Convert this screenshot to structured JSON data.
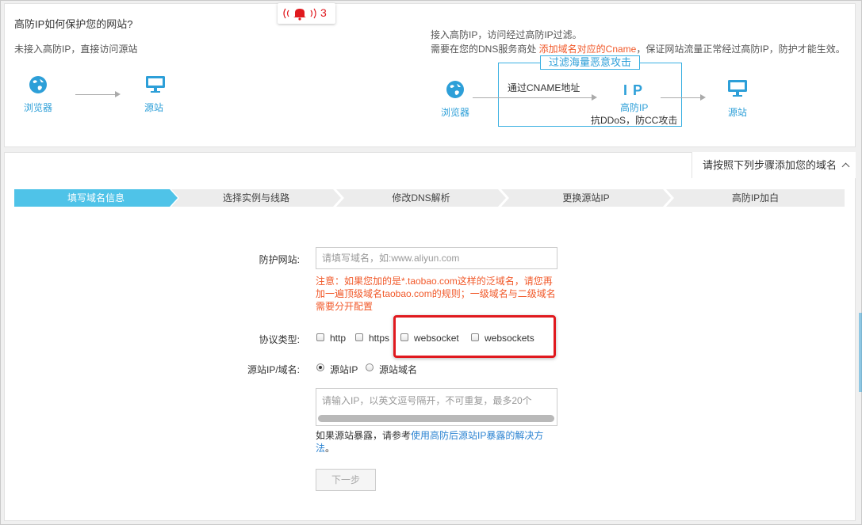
{
  "header": {
    "title": "高防IP如何保护您的网站?",
    "notification": {
      "count": "3",
      "icon": "bell-icon"
    }
  },
  "diagram_left": {
    "caption": "未接入高防IP，直接访问源站",
    "browser_label": "浏览器",
    "origin_label": "源站"
  },
  "diagram_right": {
    "line1": "接入高防IP，访问经过高防IP过滤。",
    "line2_prefix": "需要在您的DNS服务商处 ",
    "line2_highlight": "添加域名对应的Cname",
    "line2_suffix": "，保证网站流量正常经过高防IP，防护才能生效。",
    "filter_tag": "过滤海量恶意攻击",
    "cname_text": "通过CNAME地址",
    "ip_big": "I P",
    "ip_label": "高防IP",
    "ip_desc": "抗DDoS，防CC攻击",
    "browser_label": "浏览器",
    "origin_label": "源站"
  },
  "steps_toggle": "请按照下列步骤添加您的域名",
  "steps": [
    {
      "label": "填写域名信息",
      "active": true
    },
    {
      "label": "选择实例与线路",
      "active": false
    },
    {
      "label": "修改DNS解析",
      "active": false
    },
    {
      "label": "更换源站IP",
      "active": false
    },
    {
      "label": "高防IP加白",
      "active": false
    }
  ],
  "form": {
    "site_label": "防护网站:",
    "site_placeholder": "请填写域名，如:www.aliyun.com",
    "site_note_1": "注意：如果您加的是*.taobao.com这样的泛域名，请您再",
    "site_note_2": "加一遍顶级域名taobao.com的规则；一级域名与二级域名",
    "site_note_3": "需要分开配置",
    "protocol_label": "协议类型:",
    "protocols": [
      "http",
      "https",
      "websocket",
      "websockets"
    ],
    "origin_label": "源站IP/域名:",
    "origin_options": [
      "源站IP",
      "源站域名"
    ],
    "origin_selected": "源站IP",
    "origin_placeholder": "请输入IP，以英文逗号隔开，不可重复，最多20个",
    "exposure_prefix": "如果源站暴露，请参考",
    "exposure_link_1": "使用高防后源站IP暴露的解决方",
    "exposure_link_2": "法",
    "exposure_suffix": "。",
    "next_button": "下一步"
  },
  "colors": {
    "accent": "#2d9fd8",
    "step_active": "#4fc3e8",
    "warning": "#f1592a",
    "highlight_box": "#e0191e"
  }
}
